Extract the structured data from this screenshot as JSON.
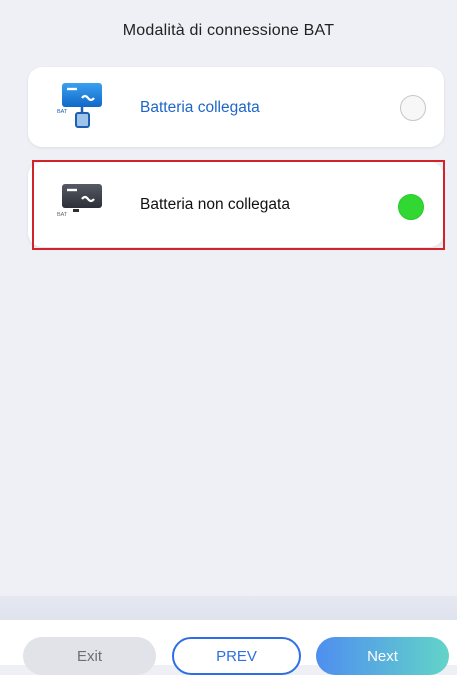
{
  "header": {
    "title": "Modalità di connessione BAT"
  },
  "options": [
    {
      "label": "Batteria collegata",
      "icon_text": "BAT",
      "icon": "inverter-battery-connected-icon",
      "selected": false
    },
    {
      "label": "Batteria non collegata",
      "icon_text": "BAT",
      "icon": "inverter-battery-disconnected-icon",
      "selected": true
    }
  ],
  "footer": {
    "exit_label": "Exit",
    "prev_label": "PREV",
    "next_label": "Next"
  },
  "colors": {
    "accent_blue": "#2e6fe2",
    "selected_green": "#32d832",
    "highlight_red": "#d2232a"
  }
}
